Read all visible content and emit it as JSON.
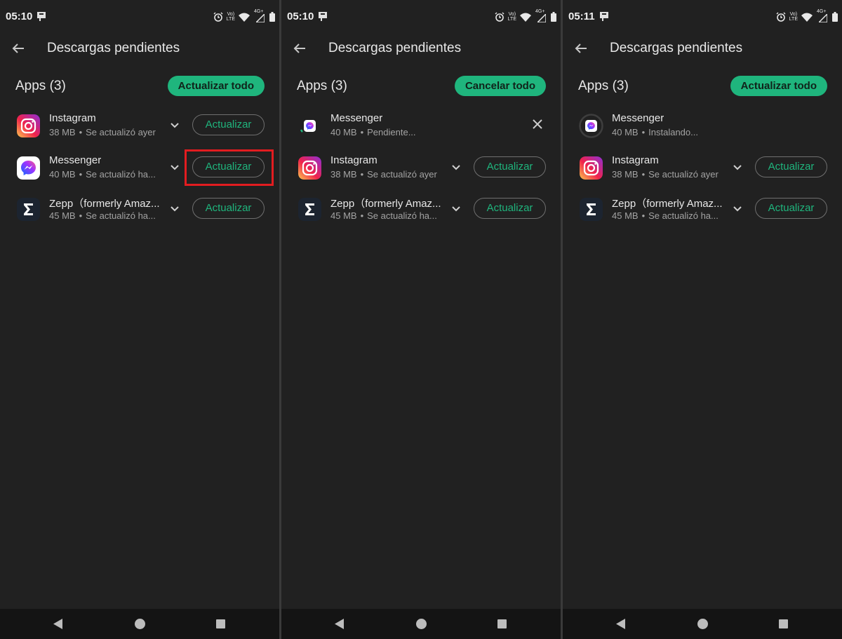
{
  "colors": {
    "background": "#212121",
    "accent_green": "#1fb57d",
    "highlight_red": "#e21c20",
    "nav_bar": "#141414"
  },
  "screens": [
    {
      "status": {
        "time": "05:10",
        "network_top": "Vo)",
        "network_bottom": "LTE",
        "signal_label": "4G+"
      },
      "title": "Descargas pendientes",
      "section_title": "Apps (3)",
      "all_button": "Actualizar todo",
      "rows": [
        {
          "name": "Instagram",
          "size": "38 MB",
          "sep": "•",
          "status": "Se actualizó ayer",
          "icon": "instagram-icon",
          "action": "Actualizar"
        },
        {
          "name": "Messenger",
          "size": "40 MB",
          "sep": "•",
          "status": "Se actualizó ha...",
          "icon": "messenger-icon",
          "action": "Actualizar"
        },
        {
          "name": "Zepp（formerly Amaz...",
          "size": "45 MB",
          "sep": "•",
          "status": "Se actualizó ha...",
          "icon": "zepp-icon",
          "action": "Actualizar"
        }
      ]
    },
    {
      "status": {
        "time": "05:10",
        "network_top": "Vo)",
        "network_bottom": "LTE",
        "signal_label": "4G+"
      },
      "title": "Descargas pendientes",
      "section_title": "Apps (3)",
      "all_button": "Cancelar todo",
      "rows": [
        {
          "name": "Messenger",
          "size": "40 MB",
          "sep": "•",
          "status": "Pendiente...",
          "icon": "messenger-icon",
          "action": "cancel"
        },
        {
          "name": "Instagram",
          "size": "38 MB",
          "sep": "•",
          "status": "Se actualizó ayer",
          "icon": "instagram-icon",
          "action": "Actualizar"
        },
        {
          "name": "Zepp（formerly Amaz...",
          "size": "45 MB",
          "sep": "•",
          "status": "Se actualizó ha...",
          "icon": "zepp-icon",
          "action": "Actualizar"
        }
      ]
    },
    {
      "status": {
        "time": "05:11",
        "network_top": "Vo)",
        "network_bottom": "LTE",
        "signal_label": "4G+"
      },
      "title": "Descargas pendientes",
      "section_title": "Apps (3)",
      "all_button": "Actualizar todo",
      "rows": [
        {
          "name": "Messenger",
          "size": "40 MB",
          "sep": "•",
          "status": "Instalando...",
          "icon": "messenger-icon",
          "action": "none"
        },
        {
          "name": "Instagram",
          "size": "38 MB",
          "sep": "•",
          "status": "Se actualizó ayer",
          "icon": "instagram-icon",
          "action": "Actualizar"
        },
        {
          "name": "Zepp（formerly Amaz...",
          "size": "45 MB",
          "sep": "•",
          "status": "Se actualizó ha...",
          "icon": "zepp-icon",
          "action": "Actualizar"
        }
      ]
    }
  ]
}
